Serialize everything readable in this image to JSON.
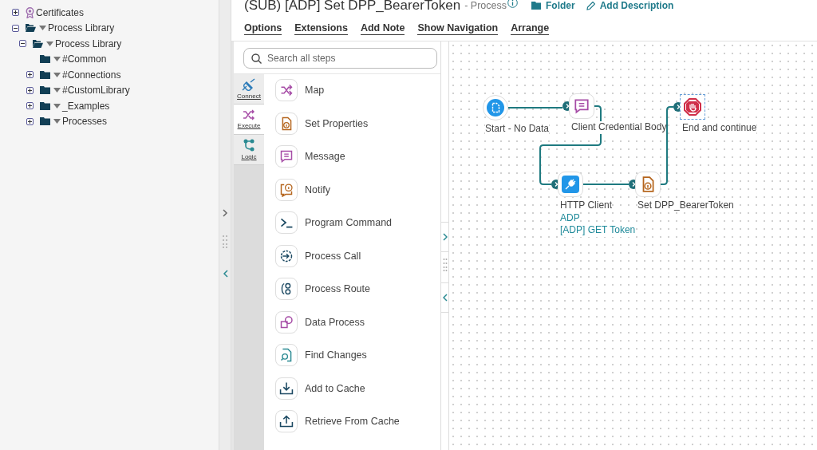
{
  "tree": [
    {
      "label": "Certificates",
      "kind": "certificate",
      "expandable": true,
      "expanded": false
    },
    {
      "label": "Process Library",
      "kind": "folder",
      "expandable": true,
      "expanded": true,
      "children": [
        {
          "label": "Process Library",
          "kind": "folder",
          "expandable": true,
          "expanded": true,
          "children": [
            {
              "label": "#Common",
              "kind": "folder",
              "expandable": false,
              "expanded": false
            },
            {
              "label": "#Connections",
              "kind": "folder",
              "expandable": true,
              "expanded": false
            },
            {
              "label": "#CustomLibrary",
              "kind": "folder",
              "expandable": true,
              "expanded": false
            },
            {
              "label": "_Examples",
              "kind": "folder",
              "expandable": true,
              "expanded": false
            },
            {
              "label": "Processes",
              "kind": "folder",
              "expandable": true,
              "expanded": false
            }
          ]
        }
      ]
    }
  ],
  "process": {
    "title": "(SUB) [ADP] Set DPP_BearerToken",
    "type": "- Process",
    "folder_link": "Folder",
    "description_link": "Add Description"
  },
  "menu": [
    "Options",
    "Extensions",
    "Add Note",
    "Show Navigation",
    "Arrange"
  ],
  "palette": {
    "search_placeholder": "Search all steps",
    "tabs": [
      {
        "label": "Connect",
        "kind": "connect",
        "selected": false
      },
      {
        "label": "Execute",
        "kind": "execute",
        "selected": true
      },
      {
        "label": "Logic",
        "kind": "logic",
        "selected": false
      }
    ],
    "steps": [
      {
        "label": "Map",
        "kind": "map"
      },
      {
        "label": "Set Properties",
        "kind": "set-properties"
      },
      {
        "label": "Message",
        "kind": "message"
      },
      {
        "label": "Notify",
        "kind": "notify"
      },
      {
        "label": "Program Command",
        "kind": "program-command"
      },
      {
        "label": "Process Call",
        "kind": "process-call"
      },
      {
        "label": "Process Route",
        "kind": "process-route"
      },
      {
        "label": "Data Process",
        "kind": "data-process"
      },
      {
        "label": "Find Changes",
        "kind": "find-changes"
      },
      {
        "label": "Add to Cache",
        "kind": "add-to-cache"
      },
      {
        "label": "Retrieve From Cache",
        "kind": "retrieve-from-cache"
      }
    ]
  },
  "canvas": {
    "nodes": [
      {
        "label": "Start - No Data",
        "kind": "start",
        "selected": false
      },
      {
        "label": "Client Credential Body",
        "kind": "message",
        "selected": false
      },
      {
        "label": "End and continue",
        "kind": "stop",
        "selected": true
      },
      {
        "label": "HTTP Client",
        "kind": "connector",
        "details": [
          "ADP",
          "[ADP] GET Token"
        ],
        "selected": false
      },
      {
        "label": "Set DPP_BearerToken",
        "kind": "set-properties",
        "selected": false
      }
    ]
  }
}
